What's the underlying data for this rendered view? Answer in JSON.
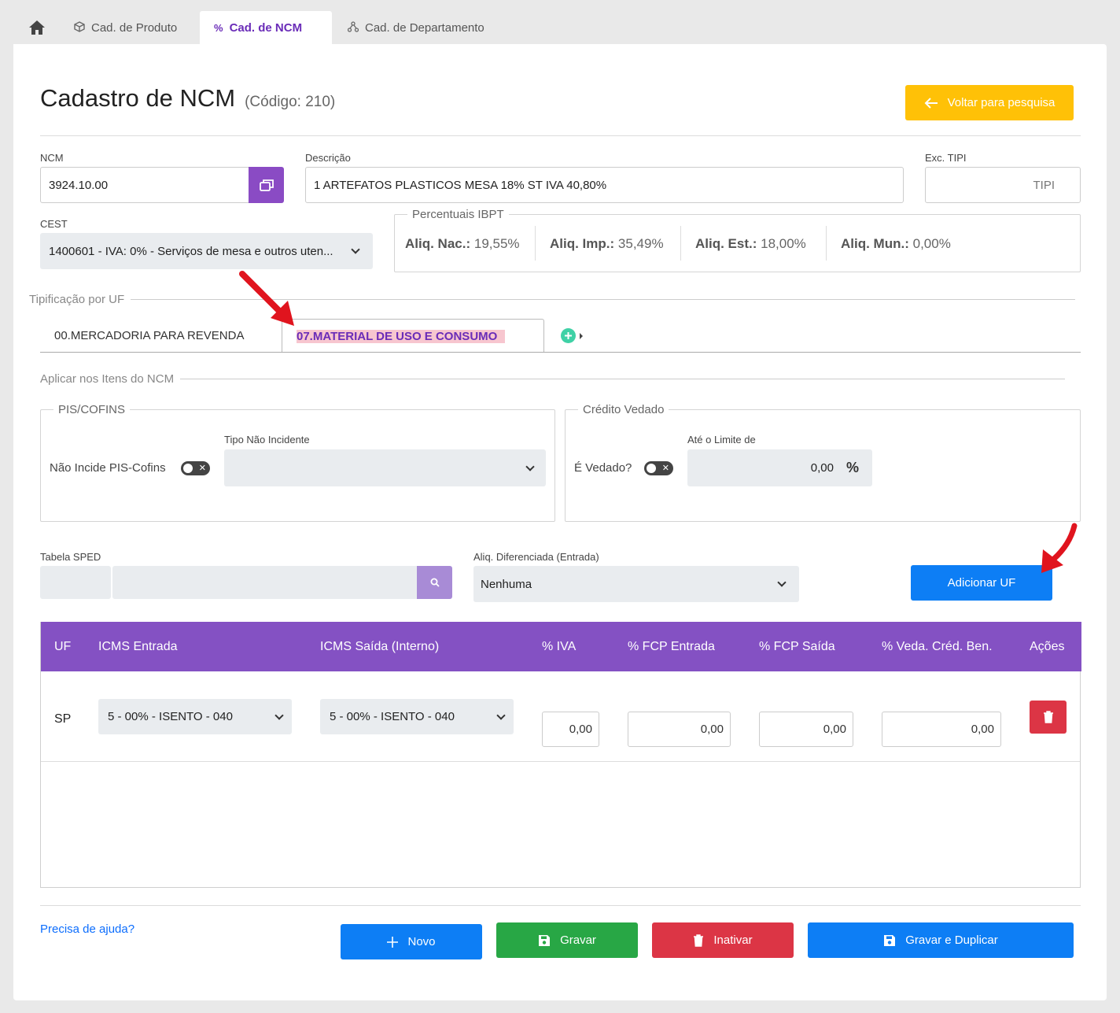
{
  "tabs": {
    "produto": "Cad. de Produto",
    "ncm": "Cad. de NCM",
    "departamento": "Cad. de Departamento"
  },
  "header": {
    "title": "Cadastro de NCM",
    "code": "(Código: 210)",
    "back_label": "Voltar para pesquisa"
  },
  "form": {
    "ncm_label": "NCM",
    "ncm_value": "3924.10.00",
    "descricao_label": "Descrição",
    "descricao_value": "1 ARTEFATOS PLASTICOS MESA 18% ST IVA 40,80%",
    "tipi_label": "Exc. TIPI",
    "tipi_placeholder": "TIPI",
    "cest_label": "CEST",
    "cest_value": "1400601 - IVA: 0% - Serviços de mesa e outros uten..."
  },
  "ibpt": {
    "legend": "Percentuais IBPT",
    "nac_label": "Aliq. Nac.:",
    "nac_value": "19,55%",
    "imp_label": "Aliq. Imp.:",
    "imp_value": "35,49%",
    "est_label": "Aliq. Est.:",
    "est_value": "18,00%",
    "mun_label": "Aliq. Mun.:",
    "mun_value": "0,00%"
  },
  "tipificacao": {
    "section": "Tipificação por UF",
    "tab1": "00.MERCADORIA PARA REVENDA",
    "tab2": "07.MATERIAL DE USO E CONSUMO"
  },
  "aplicar": {
    "section": "Aplicar nos Itens do NCM",
    "pis_legend": "PIS/COFINS",
    "pis_toggle_label": "Não Incide PIS-Cofins",
    "tipo_label": "Tipo Não Incidente",
    "credito_legend": "Crédito Vedado",
    "vedado_label": "É Vedado?",
    "limite_label": "Até o Limite de",
    "limite_value": "0,00",
    "percent": "%"
  },
  "sped": {
    "tabela_label": "Tabela SPED",
    "aliq_label": "Aliq. Diferenciada (Entrada)",
    "aliq_value": "Nenhuma",
    "add_uf_label": "Adicionar UF"
  },
  "table": {
    "headers": [
      "UF",
      "ICMS Entrada",
      "ICMS Saída (Interno)",
      "% IVA",
      "% FCP Entrada",
      "% FCP Saída",
      "% Veda. Créd. Ben.",
      "Ações"
    ],
    "rows": [
      {
        "uf": "SP",
        "icms_entrada": "5 - 00% - ISENTO - 040",
        "icms_saida": "5 - 00% - ISENTO - 040",
        "iva": "0,00",
        "fcp_entrada": "0,00",
        "fcp_saida": "0,00",
        "veda": "0,00"
      }
    ]
  },
  "footer": {
    "help": "Precisa de ajuda?",
    "novo": "Novo",
    "gravar": "Gravar",
    "inativar": "Inativar",
    "gravar_duplicar": "Gravar e Duplicar"
  },
  "colors": {
    "purple": "#8451c3",
    "yellow": "#ffc107",
    "blue": "#0d7ef5",
    "green": "#28a745",
    "red": "#dc3545"
  }
}
